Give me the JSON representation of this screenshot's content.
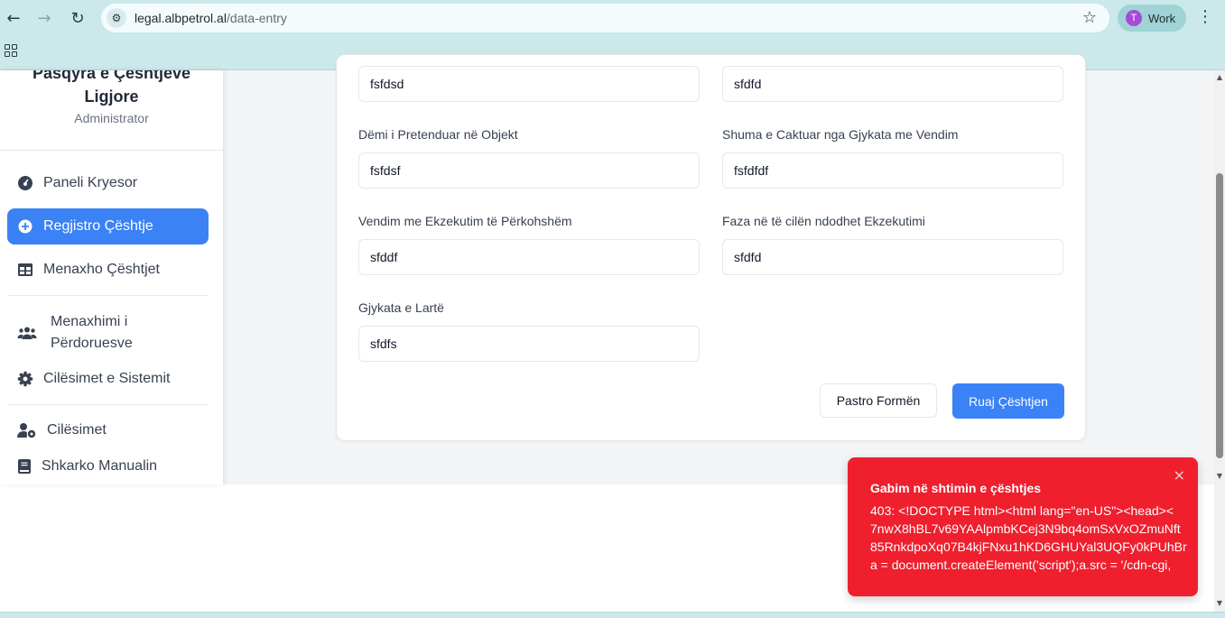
{
  "browser": {
    "url_host": "legal.albpetrol.al",
    "url_path": "/data-entry",
    "profile_initial": "T",
    "profile_label": "Work",
    "back_icon": "←",
    "forward_icon": "→",
    "reload_icon": "↻",
    "star_icon": "☆",
    "menu_icon": "⋮"
  },
  "sidebar": {
    "title_line1": "Pasqyra e Çështjeve",
    "title_line2": "Ligjore",
    "role": "Administrator",
    "items": [
      {
        "label": "Paneli Kryesor",
        "icon": "dashboard-icon"
      },
      {
        "label": "Regjistro Çështje",
        "icon": "plus-circle-icon",
        "active": true
      },
      {
        "label": "Menaxho Çështjet",
        "icon": "table-icon"
      },
      {
        "label_line1": "Menaxhimi i",
        "label_line2": "Përdoruesve",
        "icon": "users-icon"
      },
      {
        "label": "Cilësimet e Sistemit",
        "icon": "gear-icon"
      },
      {
        "label": "Cilësimet",
        "icon": "user-settings-icon"
      },
      {
        "label": "Shkarko Manualin",
        "icon": "book-icon"
      }
    ]
  },
  "form": {
    "top_left_value": "fsfdsd",
    "top_right_value": "sfdfd",
    "fields": [
      {
        "label": "Dëmi i Pretenduar në Objekt",
        "value": "fsfdsf"
      },
      {
        "label": "Shuma e Caktuar nga Gjykata me Vendim",
        "value": "fsfdfdf"
      },
      {
        "label": "Vendim me Ekzekutim të Përkohshëm",
        "value": "sfddf"
      },
      {
        "label": "Faza në të cilën ndodhet Ekzekutimi",
        "value": "sfdfd"
      },
      {
        "label": "Gjykata e Lartë",
        "value": "sfdfs"
      }
    ],
    "clear_label": "Pastro Formën",
    "save_label": "Ruaj Çështjen"
  },
  "toast": {
    "title": "Gabim në shtimin e çështjes",
    "line1": "403: <!DOCTYPE html><html lang=\"en-US\"><head><",
    "line2": "7nwX8hBL7v69YAAlpmbKCej3N9bq4omSxVxOZmuNft",
    "line3": "85RnkdpoXq07B4kjFNxu1hKD6GHUYal3UQFy0kPUhBr",
    "line4": "a = document.createElement('script');a.src = '/cdn-cgi,",
    "close_icon": "×"
  },
  "colors": {
    "accent": "#3b82f6",
    "error": "#ef1f2e",
    "chrome": "#cbe8ea"
  }
}
